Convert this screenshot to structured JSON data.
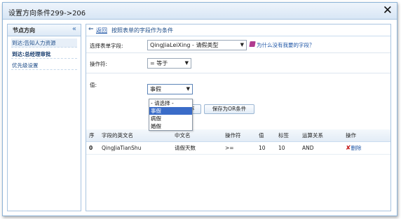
{
  "dialog": {
    "title": "设置方向条件299->206",
    "close_icon": "close-icon"
  },
  "sidebar": {
    "title": "节点方向",
    "collapse_icon": "«",
    "items": [
      {
        "label": "到达:告知人力资源"
      },
      {
        "label": "到达:总经理审批"
      },
      {
        "label": "优先级设置"
      }
    ]
  },
  "main": {
    "back_arrow": "⇐",
    "back_label": "返回",
    "header_desc": "按照表单的字段作为条件",
    "field_label": "选择表单字段:",
    "field_value": "QingJiaLeiXing - 请假类型",
    "help_icon": "book-icon",
    "help_link": "为什么没有我要的字段？",
    "operator_label": "操作符:",
    "operator_value": "= 等于",
    "value_label": "值:",
    "value_value": "事假",
    "dropdown_options": [
      "- 请选择 -",
      "事假",
      "病假",
      "婚假"
    ],
    "dropdown_selected": "事假",
    "save_and_button": "保存",
    "save_or_button": "保存为OR条件"
  },
  "table": {
    "columns": [
      "序",
      "字段的英文名",
      "中文名",
      "操作符",
      "值",
      "标签",
      "运算关系",
      "操作"
    ],
    "rows": [
      {
        "index": "0",
        "field_en": "QingJiaTianShu",
        "field_cn": "请假天数",
        "operator": ">=",
        "value": "10",
        "label": "10",
        "relation": "AND",
        "delete_label": "删除"
      }
    ]
  }
}
